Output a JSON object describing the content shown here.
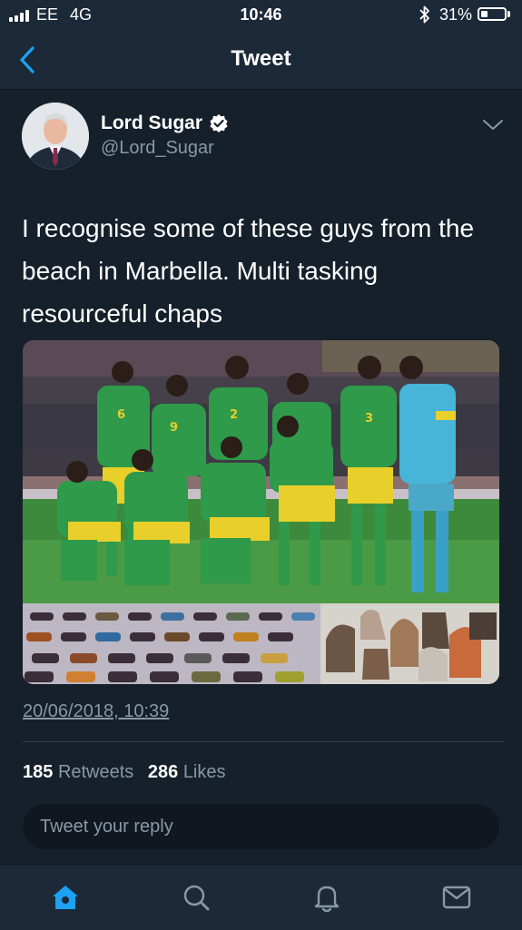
{
  "status_bar": {
    "carrier": "EE",
    "network": "4G",
    "time": "10:46",
    "battery": "31%",
    "icons": [
      "signal-bars-icon",
      "bluetooth-icon",
      "battery-icon"
    ]
  },
  "nav": {
    "title": "Tweet",
    "back_icon": "chevron-left-icon"
  },
  "tweet": {
    "user_name": "Lord Sugar",
    "handle": "@Lord_Sugar",
    "text": "I recognise some of these guys from the beach in Marbella. Multi tasking resourceful chaps",
    "timestamp": "20/06/2018, 10:39",
    "retweets_count": "185",
    "retweets_label": "Retweets",
    "likes_count": "286",
    "likes_label": "Likes"
  },
  "reply": {
    "placeholder": "Tweet your reply"
  },
  "tabs": [
    {
      "name": "home-icon",
      "active": true
    },
    {
      "name": "search-icon",
      "active": false
    },
    {
      "name": "notifications-icon",
      "active": false
    },
    {
      "name": "messages-icon",
      "active": false
    }
  ],
  "colors": {
    "background": "#15202b",
    "bar": "#1c2938",
    "accent": "#1da1f2",
    "secondary_text": "#8899a6",
    "jersey_green": "#2e9a4a",
    "shorts_yellow": "#e8cf2a"
  }
}
